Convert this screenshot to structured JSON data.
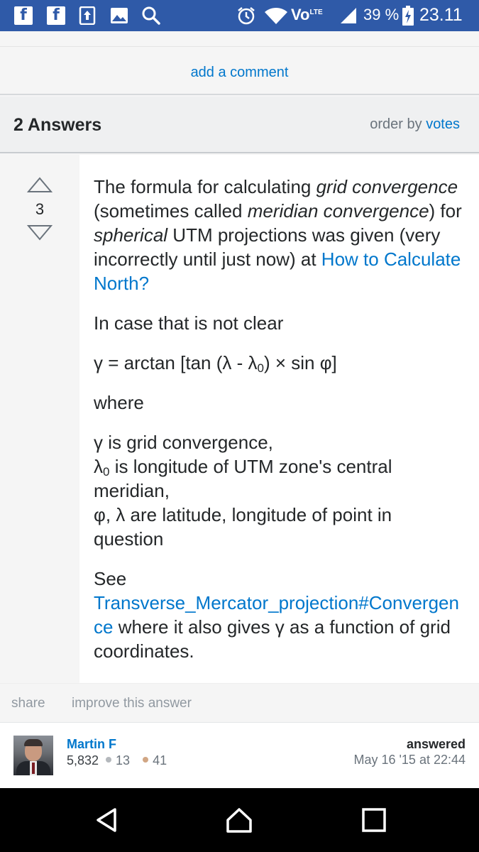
{
  "status_bar": {
    "battery": "39 %",
    "time": "23.11",
    "network": "Vo",
    "network_sub": "LTE",
    "icons": [
      "facebook-icon",
      "facebook-icon",
      "upload-icon",
      "gallery-icon",
      "search-icon",
      "alarm-icon",
      "wifi-icon",
      "volte-icon",
      "signal-icon",
      "battery-charging-icon"
    ]
  },
  "comments": {
    "add_comment_label": "add a comment"
  },
  "answers_header": {
    "count_label": "2 Answers",
    "order_by_prefix": "order by",
    "order_by_link": "votes"
  },
  "answer": {
    "votes": "3",
    "p1": {
      "t1": "The formula for calculating ",
      "e1": "grid convergence",
      "t2": " (sometimes called ",
      "e2": "meridian convergence",
      "t3": ") for ",
      "e3": "spherical",
      "t4": " UTM projections was given (very incorrectly until just now) at ",
      "link": "How to Calculate North?"
    },
    "p2": "In case that is not clear",
    "formula": {
      "a": "γ = arctan [tan (λ - λ",
      "sub": "0",
      "b": ") × sin φ]"
    },
    "p3": "where",
    "defs": {
      "d1": "γ is grid convergence,",
      "d2_a": "λ",
      "d2_sub": "0",
      "d2_b": " is longitude of UTM zone's central meridian,",
      "d3": "φ, λ are latitude, longitude of point in question"
    },
    "p4": {
      "t1": "See ",
      "link": "Transverse_Mercator_projection#Convergence",
      "t2": " where it also gives γ as a function of grid coordinates."
    }
  },
  "actions": {
    "share": "share",
    "improve": "improve this answer"
  },
  "user": {
    "name": "Martin F",
    "reputation": "5,832",
    "silver_badges": "13",
    "bronze_badges": "41",
    "silver_color": "#b4b8bc",
    "bronze_color": "#d1a684",
    "answered_label": "answered",
    "answered_date": "May 16 '15 at 22:44"
  },
  "nav": {
    "icons": [
      "back-icon",
      "home-icon",
      "recents-icon"
    ]
  }
}
